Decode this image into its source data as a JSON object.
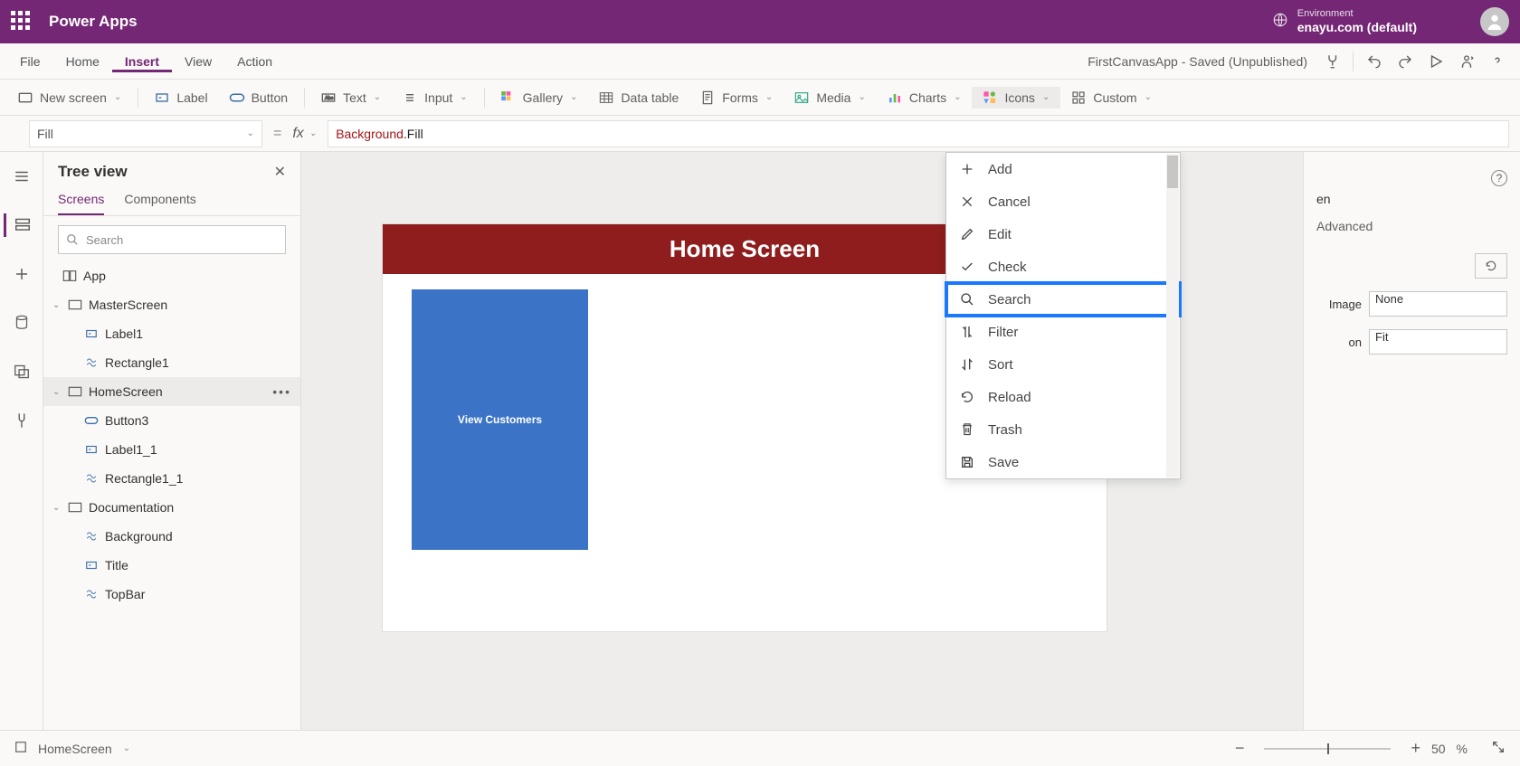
{
  "header": {
    "brand": "Power Apps",
    "env_label": "Environment",
    "env_value": "enayu.com (default)"
  },
  "menu": {
    "items": [
      "File",
      "Home",
      "Insert",
      "View",
      "Action"
    ],
    "active": "Insert",
    "filestatus": "FirstCanvasApp - Saved (Unpublished)"
  },
  "ribbon": {
    "newscreen": "New screen",
    "label": "Label",
    "button": "Button",
    "text": "Text",
    "input": "Input",
    "gallery": "Gallery",
    "datatable": "Data table",
    "forms": "Forms",
    "media": "Media",
    "charts": "Charts",
    "icons": "Icons",
    "custom": "Custom"
  },
  "fbar": {
    "property": "Fill",
    "formula_obj": "Background",
    "formula_prop": ".Fill"
  },
  "tree": {
    "title": "Tree view",
    "tabs": {
      "screens": "Screens",
      "components": "Components"
    },
    "search_placeholder": "Search",
    "items": {
      "app": "App",
      "master": "MasterScreen",
      "label1": "Label1",
      "rect1": "Rectangle1",
      "home": "HomeScreen",
      "button3": "Button3",
      "label11": "Label1_1",
      "rect11": "Rectangle1_1",
      "doc": "Documentation",
      "bg": "Background",
      "title": "Title",
      "topbar": "TopBar"
    }
  },
  "canvas": {
    "title": "Home Screen",
    "tile": "View Customers"
  },
  "iconsmenu": {
    "add": "Add",
    "cancel": "Cancel",
    "edit": "Edit",
    "check": "Check",
    "search": "Search",
    "filter": "Filter",
    "sort": "Sort",
    "reload": "Reload",
    "trash": "Trash",
    "save": "Save"
  },
  "rightpane": {
    "tab2": "Advanced",
    "row1_suffix": "en",
    "image_label": "Image",
    "image_value": "None",
    "position_label": "on",
    "position_value": "Fit"
  },
  "status": {
    "screen": "HomeScreen",
    "zoom": "50",
    "zoom_suffix": "%"
  }
}
